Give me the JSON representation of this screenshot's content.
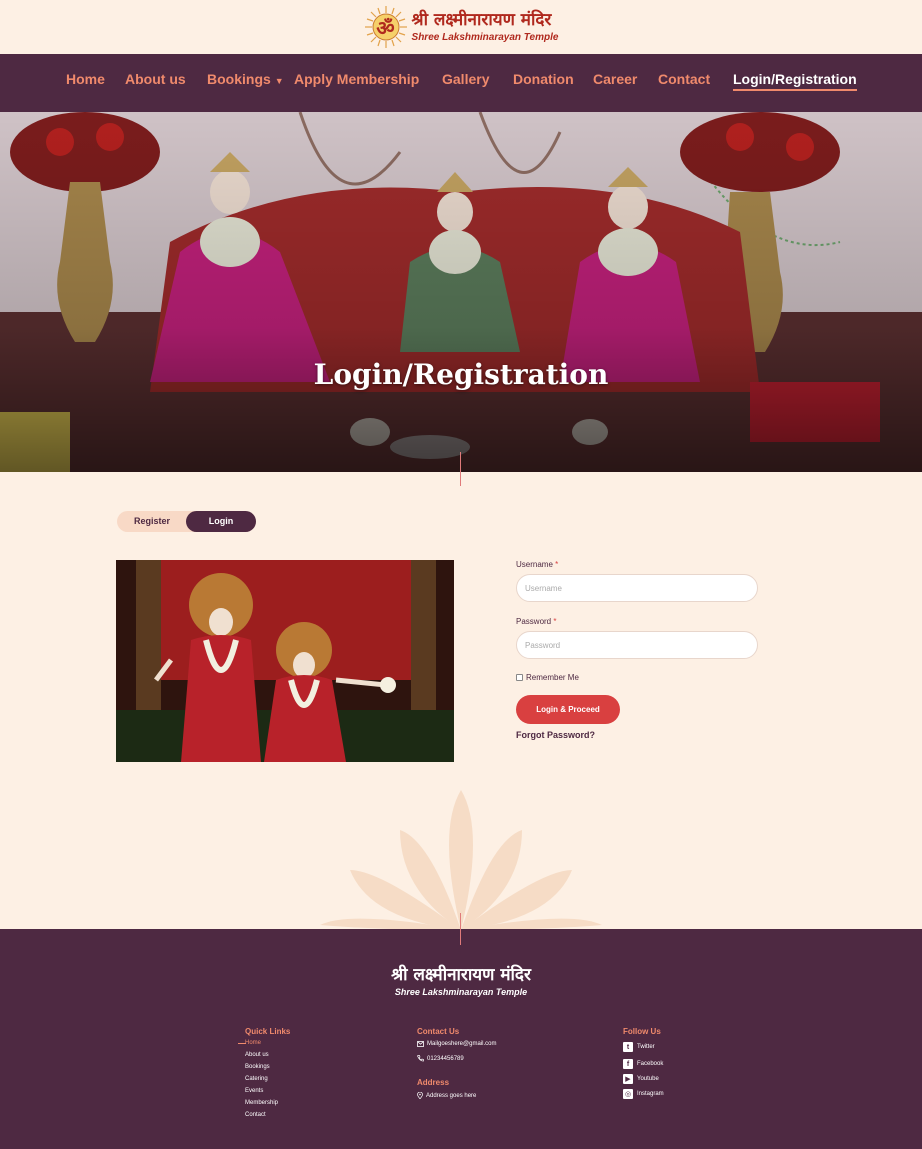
{
  "brand": {
    "om_symbol": "ॐ",
    "name_hindi": "श्री लक्ष्मीनारायण मंदिर",
    "name_english": "Shree Lakshminarayan Temple"
  },
  "nav": {
    "items": [
      {
        "label": "Home"
      },
      {
        "label": "About us"
      },
      {
        "label": "Bookings",
        "caret": "▼"
      },
      {
        "label": "Apply Membership"
      },
      {
        "label": "Gallery"
      },
      {
        "label": "Donation"
      },
      {
        "label": "Career"
      },
      {
        "label": "Contact"
      },
      {
        "label": "Login/Registration",
        "active": true
      }
    ]
  },
  "hero": {
    "title": "Login/Registration",
    "image": "temple-deities-altar-photo"
  },
  "auth_toggle": {
    "register_label": "Register",
    "login_label": "Login",
    "selected": "Login"
  },
  "photo": {
    "image": "radha-krishna-deity-photo"
  },
  "login_form": {
    "username_label": "Username",
    "username_placeholder": "Username",
    "password_label": "Password",
    "password_placeholder": "Password",
    "required_mark": "*",
    "remember_label": "Remember Me",
    "remember_checked": false,
    "submit_label": "Login & Proceed",
    "forgot_label": "Forgot Password?"
  },
  "footer": {
    "brand_hindi": "श्री लक्ष्मीनारायण मंदिर",
    "brand_english": "Shree Lakshminarayan Temple",
    "quick_links": {
      "heading": "Quick Links",
      "items": [
        "Home",
        "About us",
        "Bookings",
        "Catering",
        "Events",
        "Membership",
        "Contact"
      ]
    },
    "contact": {
      "heading": "Contact Us",
      "email": "Mailgoeshere@gmail.com",
      "phone": "01234456789",
      "address_heading": "Address",
      "address": "Address goes here"
    },
    "follow": {
      "heading": "Follow Us",
      "items": [
        {
          "label": "Twitter",
          "icon": "twitter-icon"
        },
        {
          "label": "Facebook",
          "icon": "facebook-icon"
        },
        {
          "label": "Youtube",
          "icon": "youtube-icon"
        },
        {
          "label": "Instagram",
          "icon": "instagram-icon"
        }
      ]
    }
  },
  "colors": {
    "page_bg": "#fdf0e4",
    "nav_bg": "#4e2942",
    "nav_text": "#f08a6c",
    "accent_red": "#d94040",
    "brand_red": "#b0291e"
  }
}
